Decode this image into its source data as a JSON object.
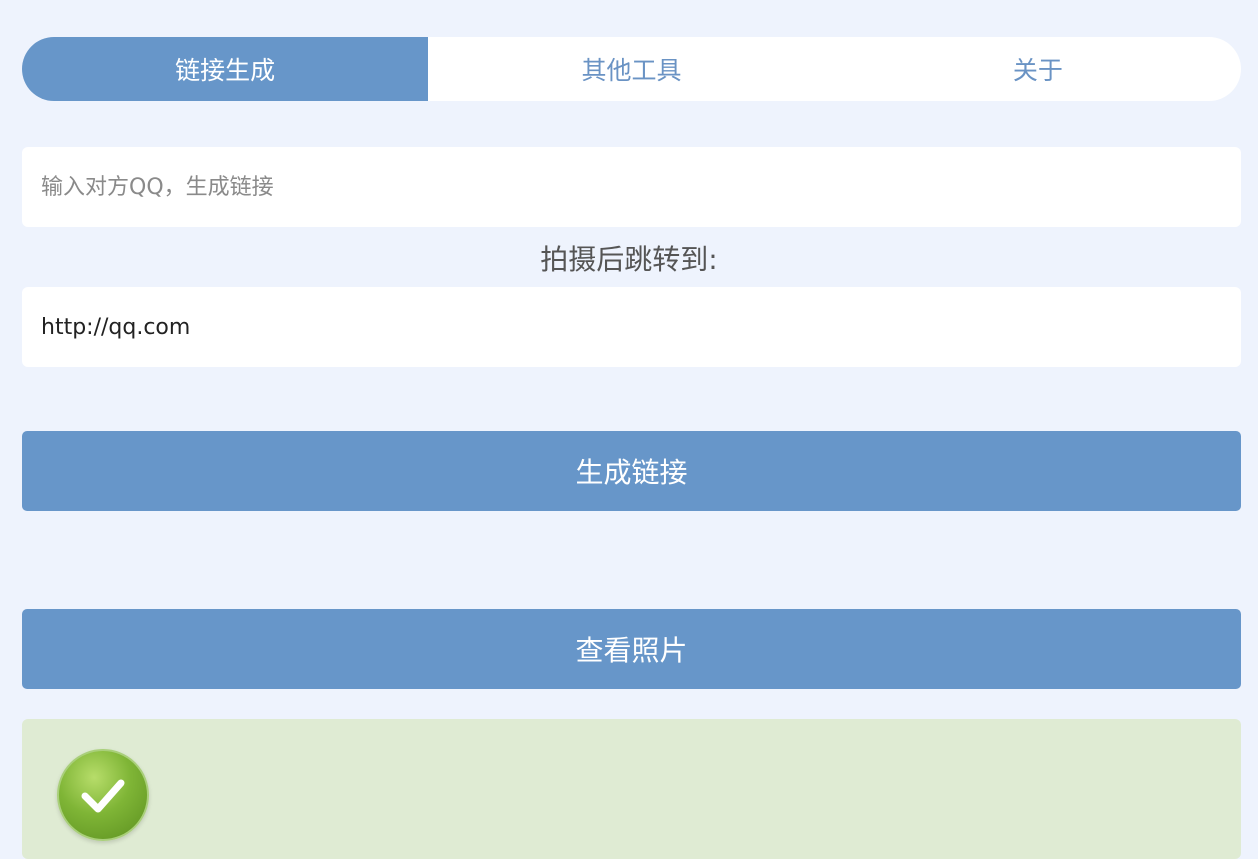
{
  "tabs": [
    {
      "label": "链接生成",
      "active": true
    },
    {
      "label": "其他工具",
      "active": false
    },
    {
      "label": "关于",
      "active": false
    }
  ],
  "form": {
    "qq_placeholder": "输入对方QQ，生成链接",
    "redirect_label": "拍摄后跳转到:",
    "redirect_value": "http://qq.com"
  },
  "buttons": {
    "generate_label": "生成链接",
    "view_label": "查看照片"
  },
  "status": {
    "icon": "check-icon",
    "panel_color": "#dfebd3"
  },
  "colors": {
    "accent": "#6796c9",
    "background": "#eef3fd"
  }
}
